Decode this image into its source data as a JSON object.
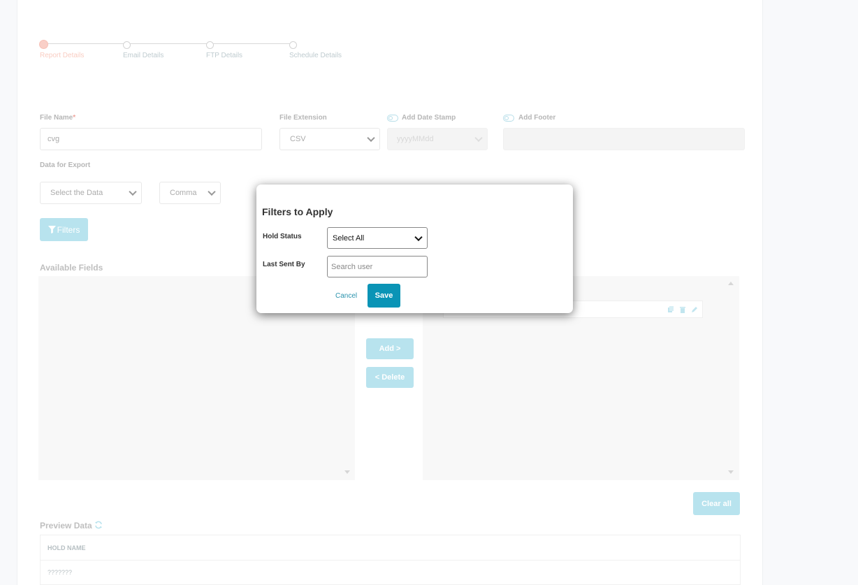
{
  "stepper": {
    "steps": [
      {
        "label": "Report Details",
        "active": true
      },
      {
        "label": "Email Details",
        "active": false
      },
      {
        "label": "FTP Details",
        "active": false
      },
      {
        "label": "Schedule Details",
        "active": false
      }
    ]
  },
  "form": {
    "file_name_label": "File Name",
    "required_mark": "*",
    "file_name_value": "cvg",
    "file_extension_label": "File Extension",
    "file_extension_value": "CSV",
    "date_stamp_label": "Add Date Stamp",
    "date_stamp_value": "yyyyMMdd",
    "footer_label": "Add Footer",
    "data_export_label": "Data for Export",
    "data_select_value": "Select the Data",
    "delimiter_value": "Comma",
    "filters_button": "Filters"
  },
  "fields": {
    "available_title": "Available Fields",
    "add_button": "Add >",
    "delete_button": "< Delete",
    "clear_all_button": "Clear all"
  },
  "preview": {
    "title": "Preview Data",
    "columns": [
      "HOLD NAME"
    ],
    "rows": [
      "???????"
    ]
  },
  "modal": {
    "title": "Filters to Apply",
    "hold_status_label": "Hold Status",
    "hold_status_value": "Select All",
    "last_sent_by_label": "Last Sent By",
    "search_placeholder": "Search user",
    "cancel_label": "Cancel",
    "save_label": "Save"
  },
  "colors": {
    "accent": "#7fcde0",
    "primary": "#0a94b6",
    "step_active": "#f4a89a"
  }
}
